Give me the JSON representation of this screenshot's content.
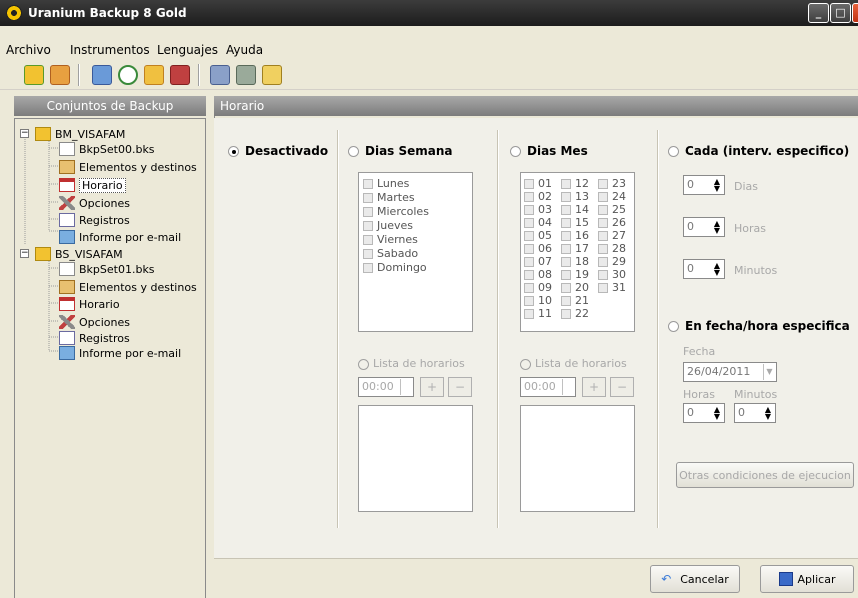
{
  "window": {
    "title": "Uranium Backup 8 Gold"
  },
  "menu": [
    "Archivo",
    "Instrumentos",
    "Lenguajes",
    "Ayuda"
  ],
  "left_panel": {
    "header": "Conjuntos de Backup",
    "tree": [
      {
        "label": "BM_VISAFAM",
        "children": [
          "BkpSet00.bks",
          "Elementos y destinos",
          "Horario",
          "Opciones",
          "Registros",
          "Informe por e-mail"
        ]
      },
      {
        "label": "BS_VISAFAM",
        "children": [
          "BkpSet01.bks",
          "Elementos y destinos",
          "Horario",
          "Opciones",
          "Registros",
          "Informe por e-mail"
        ]
      }
    ]
  },
  "right_panel": {
    "header": "Horario",
    "options": {
      "desactivado": "Desactivado",
      "dias_semana": "Dias Semana",
      "dias_mes": "Dias Mes",
      "cada": "Cada (interv. especifico)",
      "en_fecha": "En fecha/hora especifica"
    },
    "weekdays": [
      "Lunes",
      "Martes",
      "Miercoles",
      "Jueves",
      "Viernes",
      "Sabado",
      "Domingo"
    ],
    "month_days": {
      "col1": [
        "01",
        "02",
        "03",
        "04",
        "05",
        "06",
        "07",
        "08",
        "09",
        "10",
        "11"
      ],
      "col2": [
        "12",
        "13",
        "14",
        "15",
        "16",
        "17",
        "18",
        "19",
        "20",
        "21",
        "22"
      ],
      "col3": [
        "23",
        "24",
        "25",
        "26",
        "27",
        "28",
        "29",
        "30",
        "31"
      ]
    },
    "lista_horarios": "Lista de horarios",
    "time_value": "00:00",
    "plus": "+",
    "minus": "−",
    "cada": {
      "dias_value": "0",
      "dias": "Dias",
      "horas_value": "0",
      "horas": "Horas",
      "minutos_value": "0",
      "minutos": "Minutos"
    },
    "fecha": {
      "label": "Fecha",
      "value": "26/04/2011",
      "horas_label": "Horas",
      "minutos_label": "Minutos",
      "horas_value": "0",
      "minutos_value": "0"
    },
    "otras_btn": "Otras condiciones de ejecucion",
    "cancel_btn": "Cancelar",
    "apply_btn": "Aplicar"
  },
  "colors": {
    "titlebar": "#2a2a2a",
    "header": "#909090",
    "accent_folder": "#f2c230"
  }
}
